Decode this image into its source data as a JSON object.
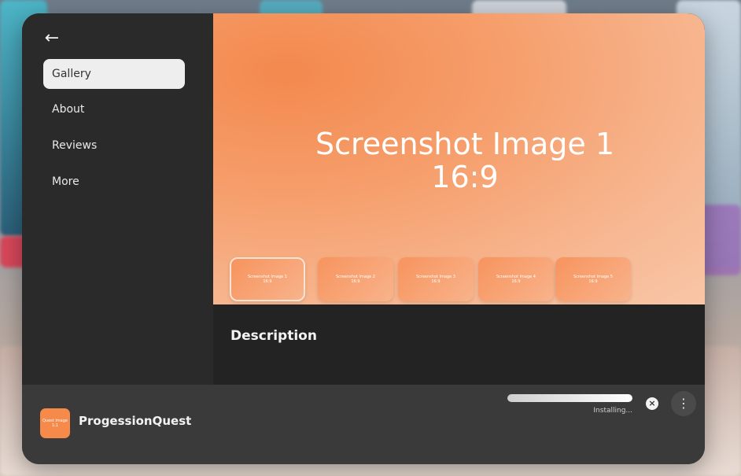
{
  "sidebar": {
    "back_icon": "arrow-left-icon",
    "items": [
      {
        "label": "Gallery",
        "active": true
      },
      {
        "label": "About",
        "active": false
      },
      {
        "label": "Reviews",
        "active": false
      },
      {
        "label": "More",
        "active": false
      }
    ]
  },
  "gallery": {
    "hero_title": "Screenshot Image 1",
    "hero_ratio": "16:9",
    "thumbnails": [
      {
        "title": "Screenshot Image 1",
        "ratio": "16:9"
      },
      {
        "title": "Screenshot Image 2",
        "ratio": "16:9"
      },
      {
        "title": "Screenshot Image 3",
        "ratio": "16:9"
      },
      {
        "title": "Screenshot Image 4",
        "ratio": "16:9"
      },
      {
        "title": "Screenshot Image 5",
        "ratio": "16:9"
      }
    ],
    "selected_index": 0
  },
  "description": {
    "title": "Description"
  },
  "app_bar": {
    "app_icon_text": "Quest Image 1:1",
    "app_name": "ProgessionQuest",
    "status": "Installing...",
    "progress": 1.0,
    "cancel_icon": "close-circle-icon",
    "more_icon": "more-vertical-icon"
  },
  "colors": {
    "accent": "#f58a4a",
    "panel": "#2b2b2b",
    "bottom_bar": "#3a3a3a"
  }
}
